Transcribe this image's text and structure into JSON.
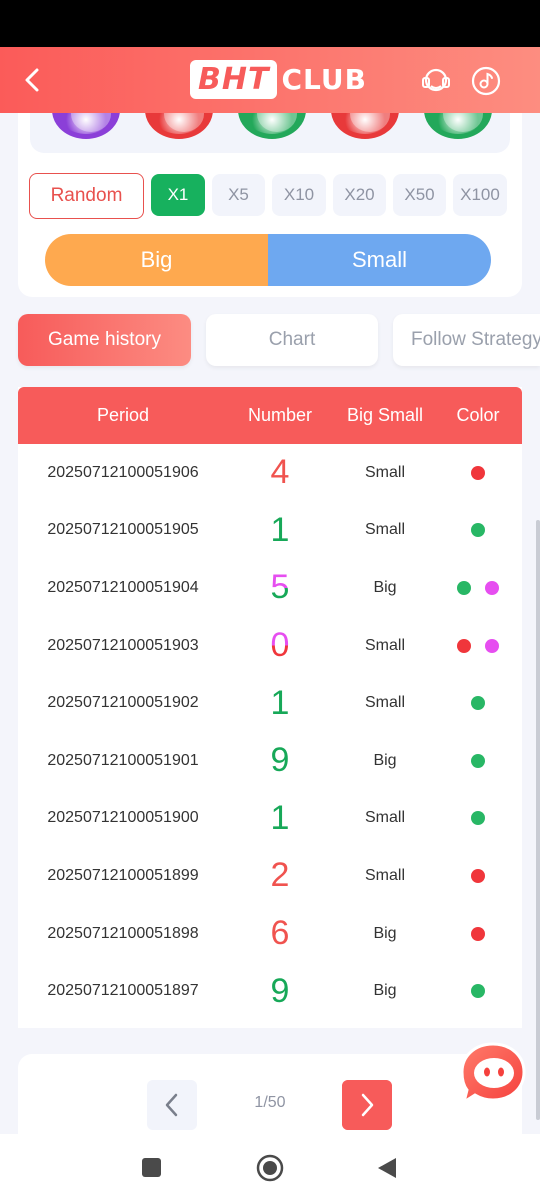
{
  "header": {
    "logo_main": "BHT",
    "logo_suffix": "CLUB",
    "icons": [
      "back-icon",
      "headset-support-icon",
      "music-icon"
    ]
  },
  "balls": [
    {
      "color": "#8b3fd8"
    },
    {
      "color": "#e8393a"
    },
    {
      "color": "#23a85a"
    },
    {
      "color": "#e8393a"
    },
    {
      "color": "#23a85a"
    }
  ],
  "bet": {
    "random_label": "Random",
    "multipliers": [
      "X1",
      "X5",
      "X10",
      "X20",
      "X50",
      "X100"
    ],
    "active_multiplier": "X1",
    "big_label": "Big",
    "small_label": "Small"
  },
  "tabs": [
    {
      "label": "Game history",
      "active": true
    },
    {
      "label": "Chart",
      "active": false
    },
    {
      "label": "Follow Strategy",
      "active": false
    }
  ],
  "table": {
    "headers": [
      "Period",
      "Number",
      "Big Small",
      "Color"
    ],
    "rows": [
      {
        "period": "20250712100051906",
        "number": "4",
        "number_color": "#f0534f",
        "size": "Small",
        "dots": [
          "#f0363b"
        ]
      },
      {
        "period": "20250712100051905",
        "number": "1",
        "number_color": "#17a858",
        "size": "Small",
        "dots": [
          "#28b765"
        ]
      },
      {
        "period": "20250712100051904",
        "number": "5",
        "number_color": "gradient-green-purple",
        "size": "Big",
        "dots": [
          "#28b765",
          "#e64ef0"
        ]
      },
      {
        "period": "20250712100051903",
        "number": "0",
        "number_color": "gradient-red-purple",
        "size": "Small",
        "dots": [
          "#f0363b",
          "#e64ef0"
        ]
      },
      {
        "period": "20250712100051902",
        "number": "1",
        "number_color": "#17a858",
        "size": "Small",
        "dots": [
          "#28b765"
        ]
      },
      {
        "period": "20250712100051901",
        "number": "9",
        "number_color": "#17a858",
        "size": "Big",
        "dots": [
          "#28b765"
        ]
      },
      {
        "period": "20250712100051900",
        "number": "1",
        "number_color": "#17a858",
        "size": "Small",
        "dots": [
          "#28b765"
        ]
      },
      {
        "period": "20250712100051899",
        "number": "2",
        "number_color": "#f0534f",
        "size": "Small",
        "dots": [
          "#f0363b"
        ]
      },
      {
        "period": "20250712100051898",
        "number": "6",
        "number_color": "#f0534f",
        "size": "Big",
        "dots": [
          "#f0363b"
        ]
      },
      {
        "period": "20250712100051897",
        "number": "9",
        "number_color": "#17a858",
        "size": "Big",
        "dots": [
          "#28b765"
        ]
      }
    ]
  },
  "pagination": {
    "label": "1/50"
  },
  "colors": {
    "accent": "#f75b5a",
    "green": "#17b15e",
    "big": "#fea94f",
    "small": "#6ea8f0"
  }
}
